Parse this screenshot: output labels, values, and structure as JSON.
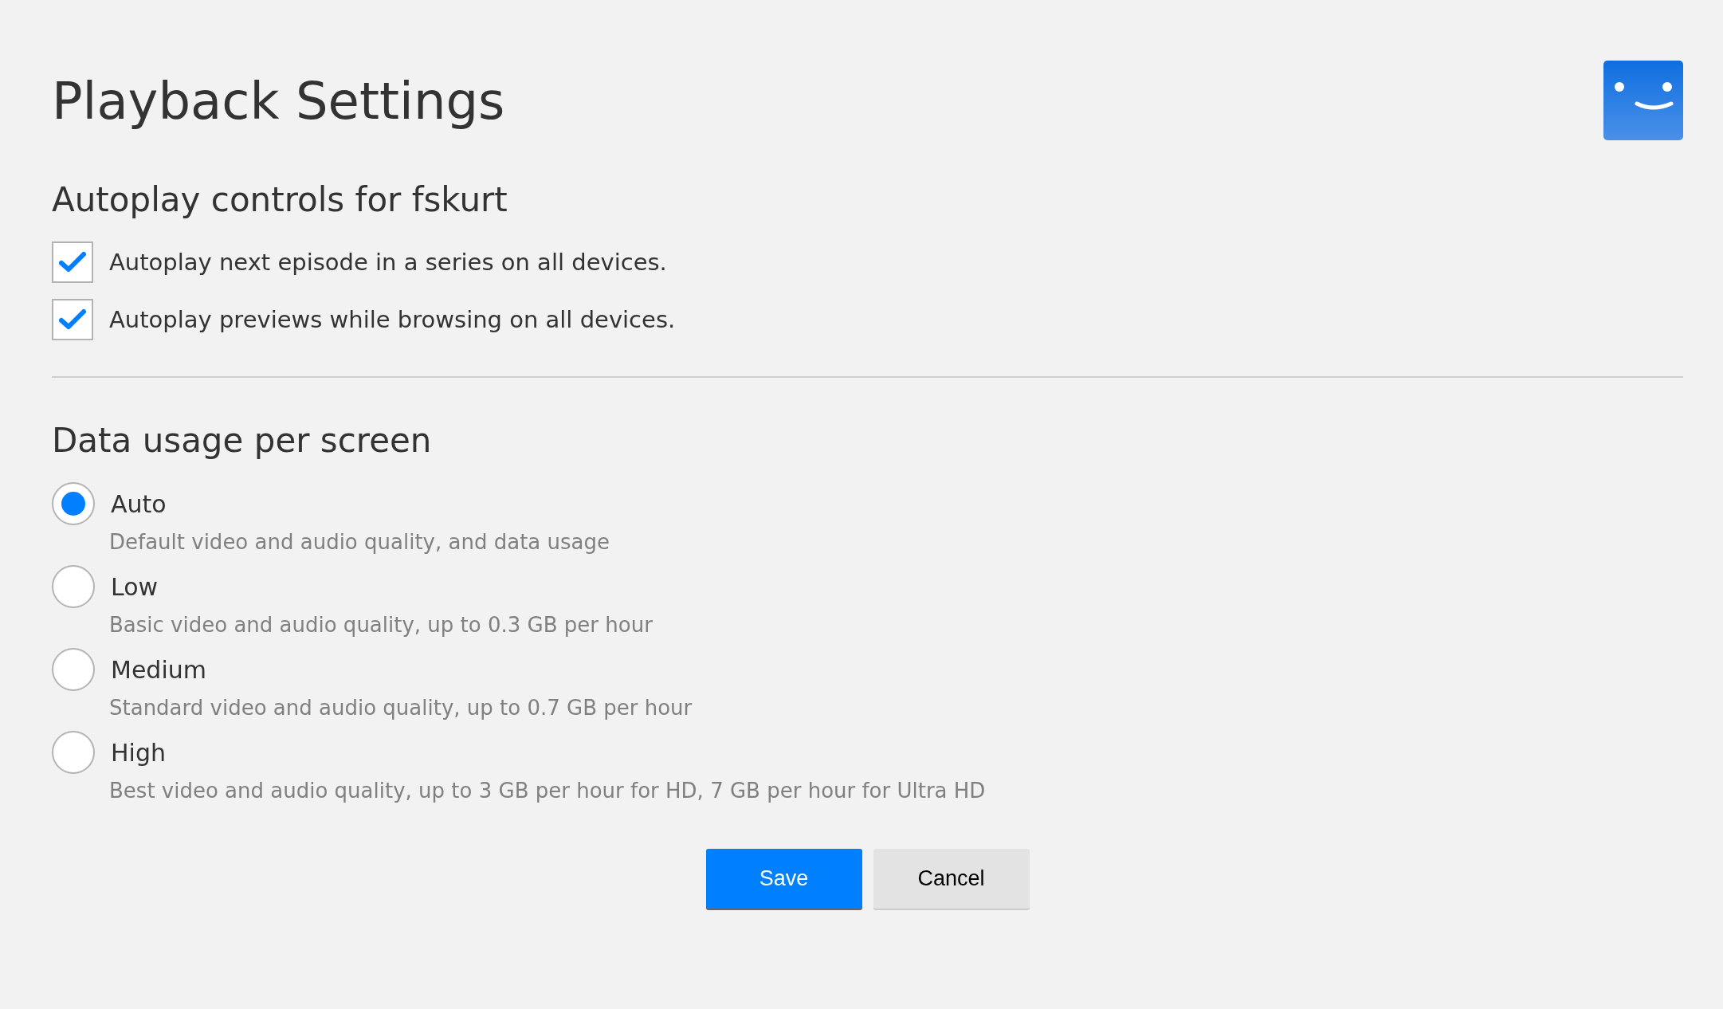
{
  "title": "Playback Settings",
  "autoplay": {
    "heading": "Autoplay controls for fskurt",
    "options": [
      {
        "label": "Autoplay next episode in a series on all devices.",
        "checked": true
      },
      {
        "label": "Autoplay previews while browsing on all devices.",
        "checked": true
      }
    ]
  },
  "data_usage": {
    "heading": "Data usage per screen",
    "options": [
      {
        "label": "Auto",
        "description": "Default video and audio quality, and data usage",
        "selected": true
      },
      {
        "label": "Low",
        "description": "Basic video and audio quality, up to 0.3 GB per hour",
        "selected": false
      },
      {
        "label": "Medium",
        "description": "Standard video and audio quality, up to 0.7 GB per hour",
        "selected": false
      },
      {
        "label": "High",
        "description": "Best video and audio quality, up to 3 GB per hour for HD, 7 GB per hour for Ultra HD",
        "selected": false
      }
    ]
  },
  "buttons": [
    {
      "label": "Save",
      "kind": "primary"
    },
    {
      "label": "Cancel",
      "kind": "secondary"
    }
  ]
}
